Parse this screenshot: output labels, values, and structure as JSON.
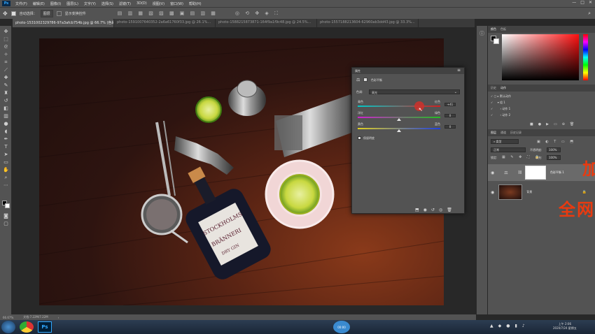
{
  "app": {
    "logo": "Ps",
    "menu": [
      "文件(F)",
      "编辑(E)",
      "图像(I)",
      "图层(L)",
      "文字(Y)",
      "选择(S)",
      "滤镜(T)",
      "3D(D)",
      "视图(V)",
      "窗口(W)",
      "帮助(H)"
    ],
    "window_controls": [
      "—",
      "□",
      "✕"
    ]
  },
  "options_bar": {
    "auto_select_label": "自动选择：",
    "auto_select_value": "图层",
    "show_transform_label": "显示变换控件"
  },
  "tabs": [
    {
      "label": "photo-1531002329786-97a3afcb754b.jpg @ 66.7% (色彩平衡 1, 图层蒙版/8) *",
      "active": true
    },
    {
      "label": "photo-1591007640352-2a6a61760f33.jpg @ 26.1%...",
      "active": false
    },
    {
      "label": "photo-1588215873871-164f9a1f9c48.jpg @ 24.5%...",
      "active": false
    },
    {
      "label": "photo-1557188213604-62960ab3dd43.jpg @ 33.3%...",
      "active": false
    }
  ],
  "status_bar": {
    "zoom": "66.67%",
    "doc": "文档:7.22M/7.22M"
  },
  "properties": {
    "header": "属性",
    "title": "色彩平衡",
    "tone_label": "色调:",
    "tone_value": "高光",
    "sliders": [
      {
        "left": "青色",
        "right": "红色",
        "value": "+41"
      },
      {
        "left": "洋红",
        "right": "绿色",
        "value": "0"
      },
      {
        "left": "黄色",
        "right": "蓝色",
        "value": "0"
      }
    ],
    "preserve_label": "保留明度",
    "preserve_checked": true
  },
  "right_panels": {
    "color_tabs": [
      "颜色",
      "色板"
    ],
    "history_tabs": [
      "历史",
      "动作"
    ],
    "actions": [
      {
        "label": "默认动作",
        "indent": 0
      },
      {
        "label": "组 1",
        "indent": 1
      },
      {
        "label": "动作 1",
        "indent": 2
      },
      {
        "label": "动作 2",
        "indent": 2
      }
    ],
    "layers_tabs": [
      "图层",
      "通道",
      "历史记录"
    ],
    "kind_label": "类型",
    "blend_mode": "正常",
    "opacity_label": "不透明度:",
    "opacity_value": "100%",
    "lock_label": "锁定:",
    "fill_label": "填充:",
    "fill_value": "100%",
    "layers": [
      {
        "name": "色彩平衡 1",
        "type": "adjustment"
      },
      {
        "name": "背景",
        "type": "image"
      }
    ]
  },
  "watermark": {
    "line1": "加",
    "line2": "全网"
  },
  "taskbar": {
    "center_label": "00:00",
    "time": "上午 2:06",
    "date": "2020/7/24 星期五"
  },
  "photo_labels": {
    "bottle_line1": "STOCKHOLMS",
    "bottle_line2": "BRÄNNERI",
    "bottle_line3": "DRY GIN"
  },
  "colors": {
    "accent": "#31a8ff",
    "watermark": "#e83a10",
    "slider_red": "#d0302a"
  }
}
